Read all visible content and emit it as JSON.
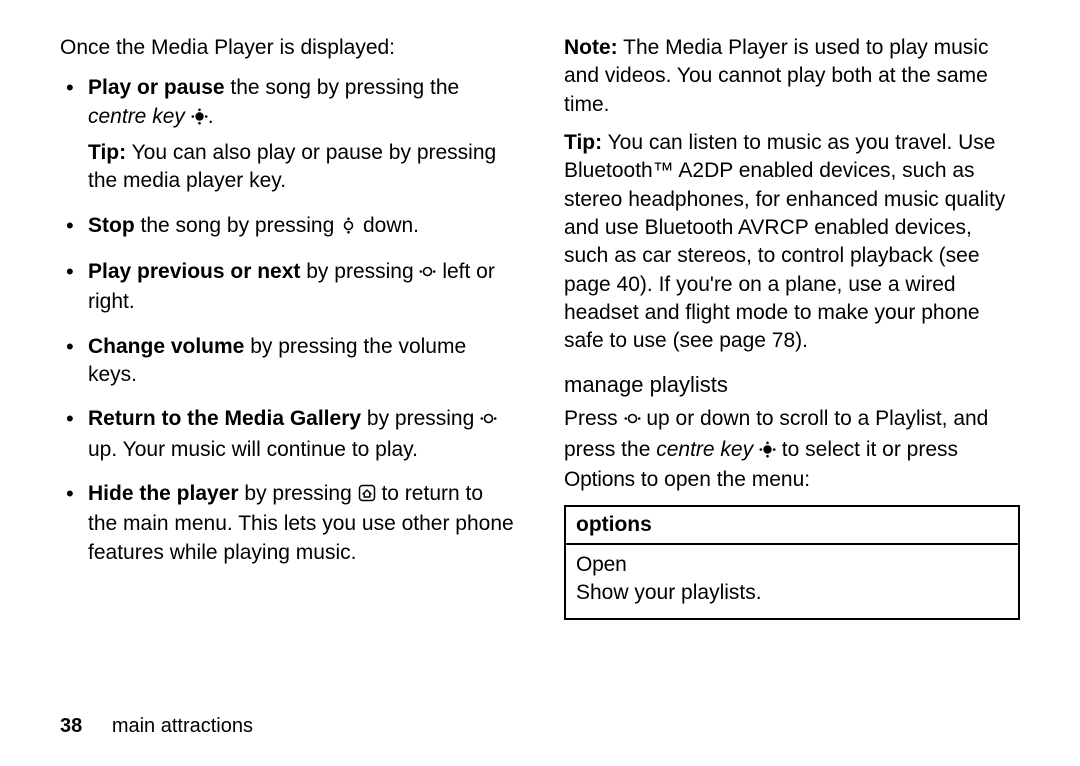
{
  "left": {
    "intro": "Once the Media Player is displayed:",
    "bullets": [
      {
        "lead_b": "Play or pause",
        "rest1": " the song by pressing the ",
        "em": "centre key",
        "afterIcon": ".",
        "icon": "centre-key-icon",
        "tip_label": "Tip:",
        "tip": " You can also play or pause by pressing the media player key."
      },
      {
        "lead_b": "Stop",
        "rest1": " the song by pressing ",
        "icon": "nav-vertical-icon",
        "afterIcon": " down."
      },
      {
        "lead_b": "Play previous or next",
        "rest1": " by pressing ",
        "icon": "nav-horizontal-icon",
        "afterIcon": " left or right."
      },
      {
        "lead_b": "Change volume",
        "rest1": " by pressing the volume keys."
      },
      {
        "lead_b": "Return to the Media Gallery",
        "rest1": " by pressing ",
        "icon": "nav-horizontal-icon",
        "afterIcon": " up. Your music will continue to play."
      },
      {
        "lead_b": "Hide the player",
        "rest1": " by pressing ",
        "icon": "home-icon",
        "afterIcon": " to return to the main menu. This lets you use other phone features while playing music."
      }
    ]
  },
  "right": {
    "note_label": "Note:",
    "note": " The Media Player is used to play music and videos. You cannot play both at the same time.",
    "tip_label": "Tip:",
    "tip": " You can listen to music as you travel. Use Bluetooth™ A2DP enabled devices, such as stereo headphones, for enhanced music quality and use Bluetooth AVRCP enabled devices, such as car stereos, to control playback (see page 40). If you're on a plane, use a wired headset and flight mode to make your phone safe to use (see page 78).",
    "subhead": "manage playlists",
    "para_pre": "Press ",
    "para_icon": "nav-horizontal-icon",
    "para_mid": " up or down to scroll to a Playlist, and press the ",
    "para_em": "centre key",
    "para_icon2": "centre-key-icon",
    "para_mid2": " to select it or press ",
    "para_cond": "Options",
    "para_end": " to open the menu:",
    "table": {
      "header": "options",
      "row_title": "Open",
      "row_body": "Show your playlists."
    }
  },
  "footer": {
    "page": "38",
    "section": "main attractions"
  }
}
